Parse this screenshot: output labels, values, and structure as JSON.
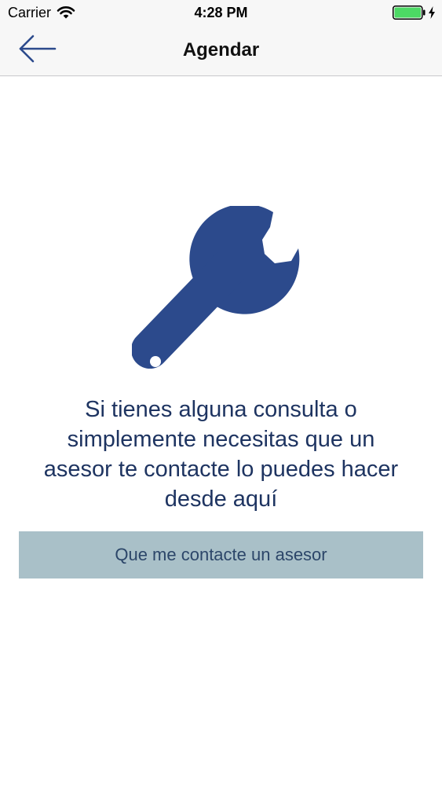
{
  "status_bar": {
    "carrier": "Carrier",
    "time": "4:28 PM",
    "battery_color": "#4cd964"
  },
  "nav": {
    "title": "Agendar",
    "back_icon": "arrow-left-icon"
  },
  "main": {
    "icon": "wrench-icon",
    "icon_color": "#2c4a8c",
    "message_lines": [
      "Si tienes alguna consulta o",
      "simplemente necesitas que un",
      "asesor te contacte lo puedes hacer",
      "desde aquí"
    ],
    "contact_button_label": "Que me contacte un asesor",
    "button_color": "#a9c0c8",
    "text_color": "#1e3461"
  }
}
